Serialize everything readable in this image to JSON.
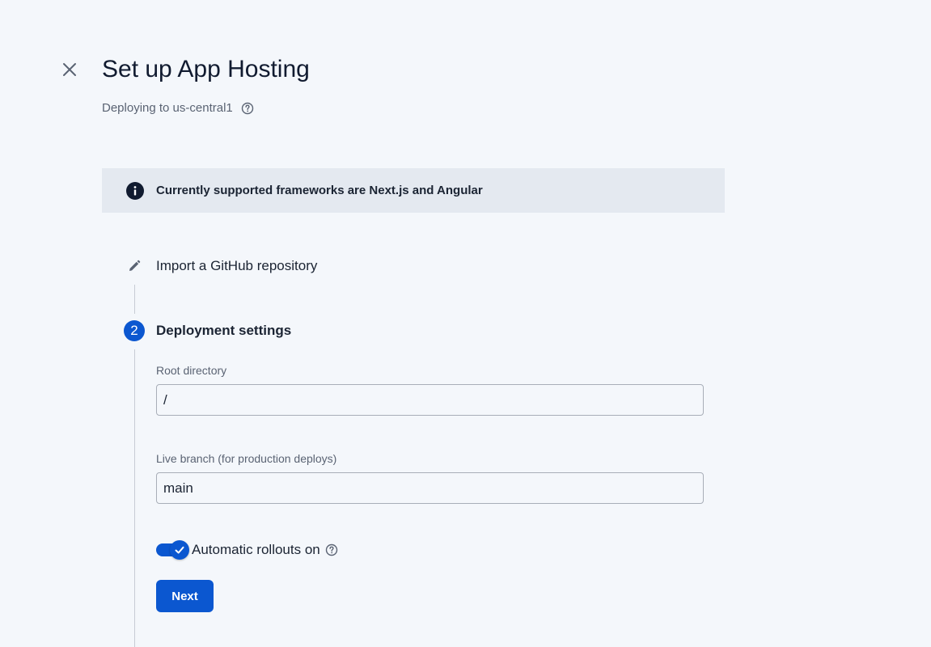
{
  "header": {
    "title": "Set up App Hosting",
    "subtitle": "Deploying to us-central1",
    "close_icon": "close-icon",
    "help_icon": "help-circle-icon"
  },
  "banner": {
    "icon": "info-icon",
    "text": "Currently supported frameworks are Next.js and Angular"
  },
  "steps": [
    {
      "icon": "pencil-icon",
      "label": "Import a GitHub repository"
    },
    {
      "number": "2",
      "label": "Deployment settings"
    }
  ],
  "form": {
    "root_directory": {
      "label": "Root directory",
      "value": "/"
    },
    "live_branch": {
      "label": "Live branch (for production deploys)",
      "value": "main"
    },
    "rollouts_toggle": {
      "label": "Automatic rollouts on",
      "checked": true,
      "help_icon": "help-circle-icon"
    },
    "next_label": "Next"
  },
  "colors": {
    "accent": "#0b57d0",
    "background": "#f4f7fb",
    "banner_bg": "#e4e9f0",
    "text_primary": "#1b2433",
    "text_secondary": "#5a6373"
  }
}
